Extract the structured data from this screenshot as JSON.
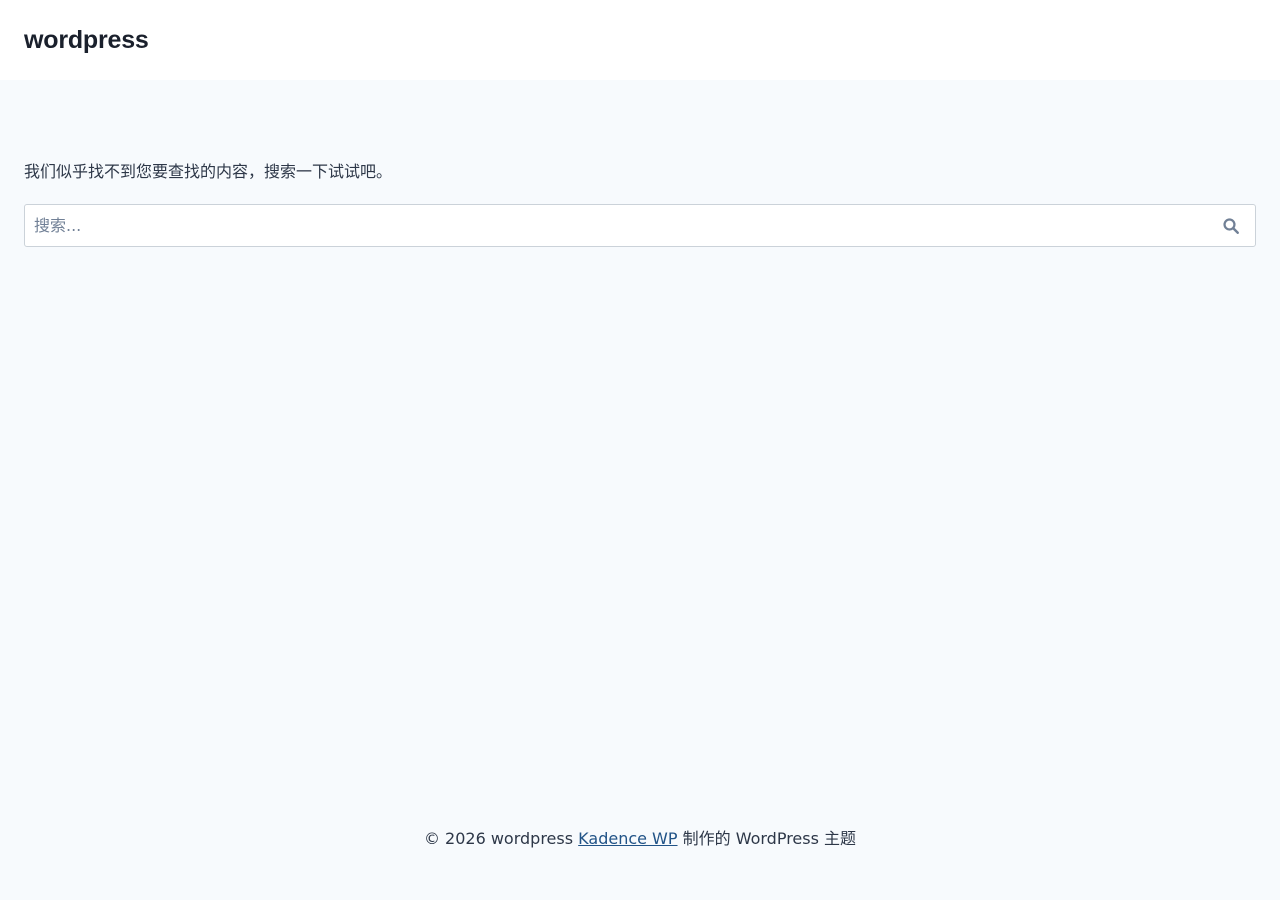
{
  "header": {
    "site_title": "wordpress"
  },
  "main": {
    "notice": "我们似乎找不到您要查找的内容，搜索一下试试吧。",
    "search": {
      "placeholder": "搜索...",
      "value": "",
      "submit_icon": "search-icon"
    }
  },
  "footer": {
    "prefix": "© 2026 wordpress",
    "link_text": "Kadence WP",
    "suffix": "制作的 WordPress 主题"
  },
  "colors": {
    "page_background": "#f7fafd",
    "header_background": "#ffffff",
    "text": "#2d3748",
    "link": "#215387",
    "icon": "#718096",
    "input_border": "#cbd2d9"
  }
}
